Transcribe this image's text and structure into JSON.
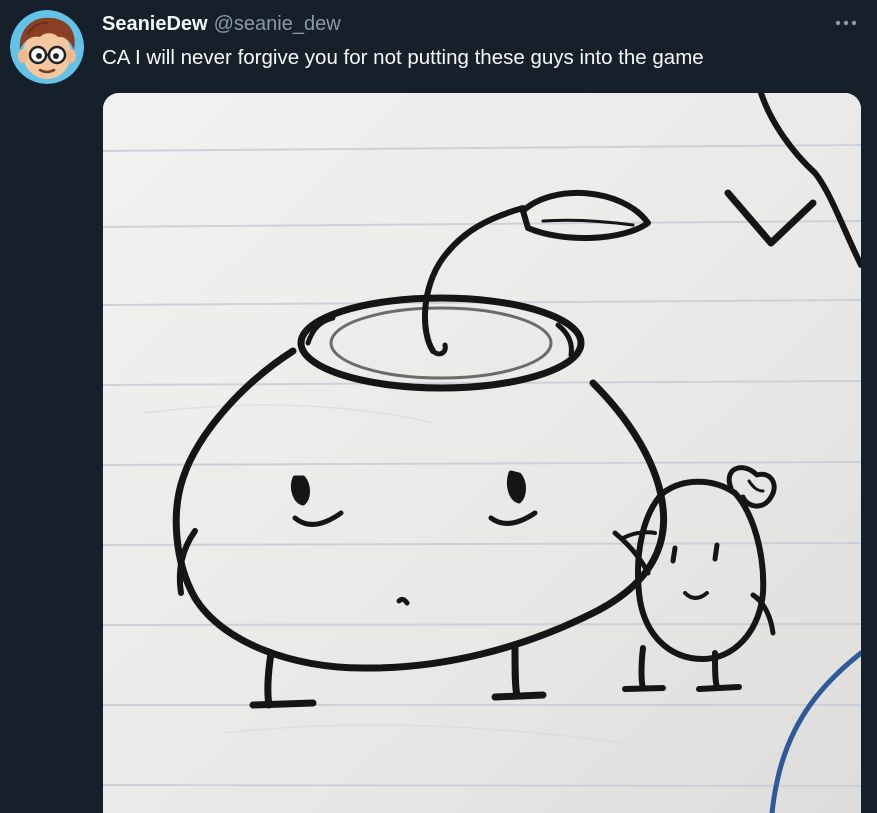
{
  "tweet": {
    "display_name": "SeanieDew",
    "handle": "@seanie_dew",
    "text": "CA I will never forgive you for not putting these guys into the game",
    "avatar_icon": "cartoon-avatar-icon",
    "more_icon": "more-options-icon",
    "media_description": "pencil-sketch-image"
  },
  "colors": {
    "background": "#15202b",
    "primary_text": "#f7f9f9",
    "secondary_text": "#8b98a5",
    "paper": "#ececea",
    "ruled_line": "#c9cfd6",
    "ink": "#151515",
    "blue_ink": "#2f5a9a"
  }
}
